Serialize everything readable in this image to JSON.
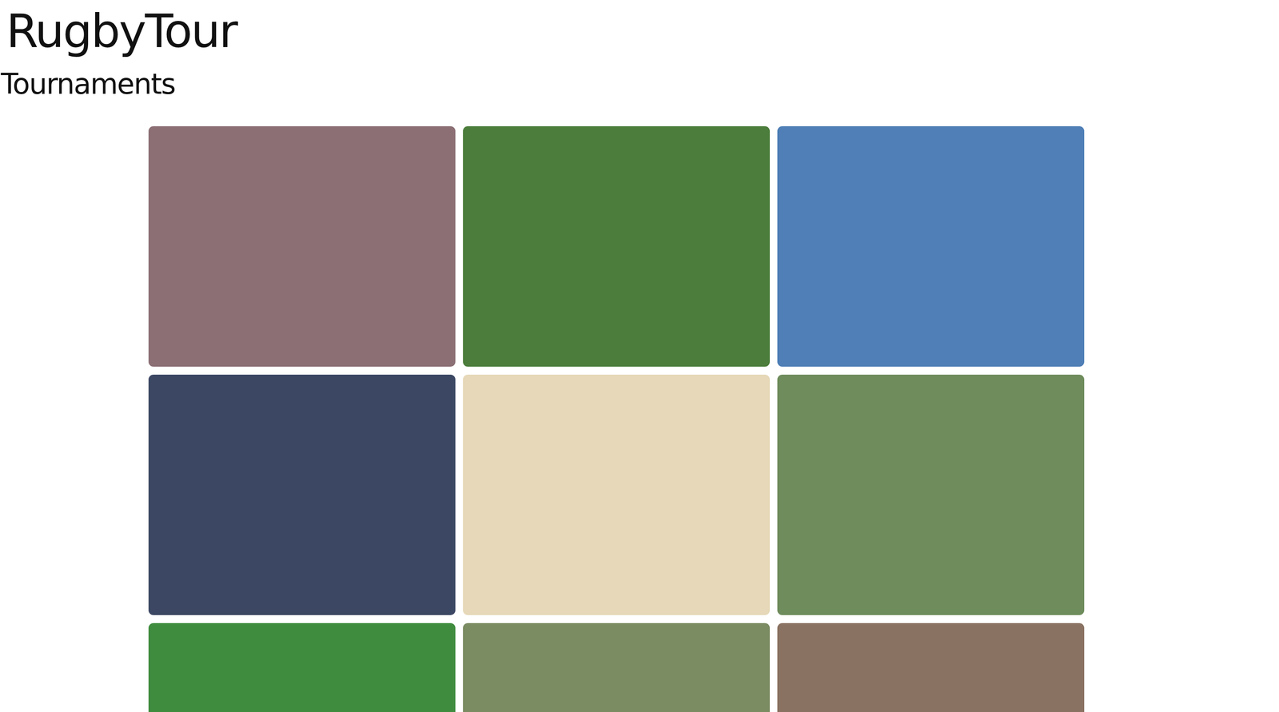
{
  "brand": "RugbyTour",
  "heading": "Tournaments",
  "tournaments": [
    {
      "color": "#8b6f74"
    },
    {
      "color": "#4c7d3c"
    },
    {
      "color": "#4f7fb6"
    },
    {
      "color": "#3b4763"
    },
    {
      "color": "#e6d8b8"
    },
    {
      "color": "#6e8c5c"
    },
    {
      "color": "#3f8c3e"
    },
    {
      "color": "#7b8b62"
    },
    {
      "color": "#8a7262"
    }
  ]
}
